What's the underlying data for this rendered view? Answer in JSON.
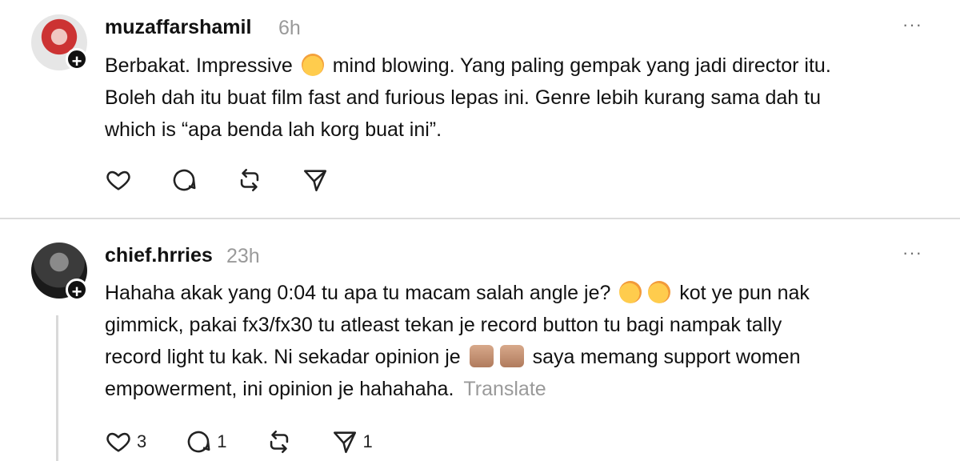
{
  "posts": [
    {
      "username": "muzaffarshamil",
      "time": "6h",
      "text_lines": [
        [
          "Berbakat. Impressive ",
          "emoji:exploding-head",
          " mind blowing. Yang paling gempak yang jadi director itu."
        ],
        [
          "Boleh dah itu buat film fast and furious lepas ini. Genre lebih kurang sama dah tu"
        ],
        [
          "which is “apa benda lah korg buat ini”."
        ]
      ],
      "counts": {
        "likes": "",
        "replies": "",
        "reposts": "",
        "shares": ""
      }
    },
    {
      "username": "chief.hrries",
      "time": "23h",
      "text": {
        "line1_a": "Hahaha akak yang 0:04 tu apa tu macam salah angle je?",
        "line1_b": "kot ye pun nak",
        "line2": "gimmick, pakai fx3/fx30 tu atleast tekan je record button tu bagi nampak tally",
        "line3_a": "record light tu kak. Ni sekadar opinion je",
        "line3_b": "saya memang support women",
        "line4": "empowerment, ini opinion je hahahaha."
      },
      "translate_label": "Translate",
      "counts": {
        "likes": "3",
        "replies": "1",
        "reposts": "",
        "shares": "1"
      }
    }
  ],
  "icons": {
    "more": "more-horizontal-icon",
    "like": "heart-icon",
    "reply": "comment-icon",
    "repost": "repost-icon",
    "share": "send-icon"
  },
  "more_label": "···"
}
